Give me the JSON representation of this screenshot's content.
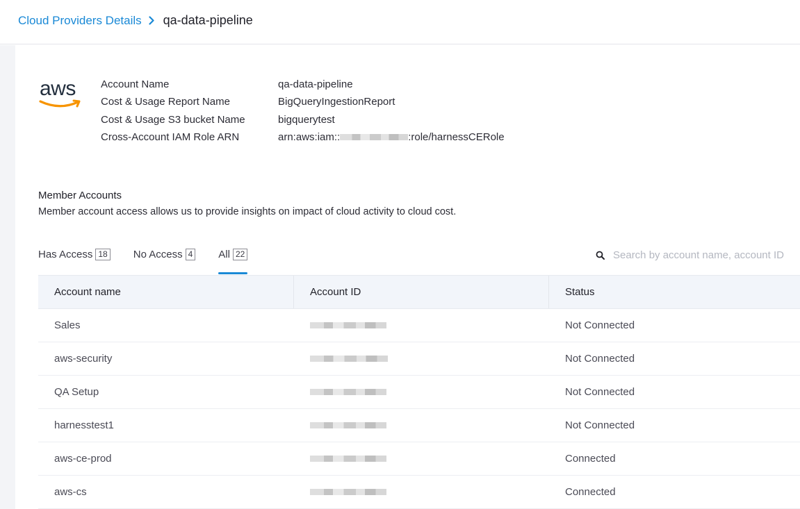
{
  "breadcrumb": {
    "parent": "Cloud Providers Details",
    "current": "qa-data-pipeline"
  },
  "provider": {
    "logo_text": "aws",
    "details": [
      {
        "label": "Account Name",
        "value": "qa-data-pipeline"
      },
      {
        "label": "Cost & Usage Report Name",
        "value": "BigQueryIngestionReport"
      },
      {
        "label": "Cost & Usage S3 bucket Name",
        "value": "bigquerytest"
      },
      {
        "label": "Cross-Account IAM Role ARN",
        "value_prefix": "arn:aws:iam::",
        "value_suffix": ":role/harnessCERole"
      }
    ]
  },
  "member_accounts": {
    "title": "Member Accounts",
    "description": "Member account access allows us to provide insights on impact of cloud activity to cloud cost."
  },
  "tabs": [
    {
      "label": "Has Access",
      "count": "18",
      "active": false
    },
    {
      "label": "No Access",
      "count": "4",
      "active": false
    },
    {
      "label": "All",
      "count": "22",
      "active": true
    }
  ],
  "search": {
    "placeholder": "Search by account name, account ID",
    "icon": "search-icon"
  },
  "table": {
    "columns": [
      "Account name",
      "Account ID",
      "Status"
    ],
    "rows": [
      {
        "name": "Sales",
        "status": "Not Connected"
      },
      {
        "name": "aws-security",
        "status": "Not Connected"
      },
      {
        "name": "QA Setup",
        "status": "Not Connected"
      },
      {
        "name": "harnesstest1",
        "status": "Not Connected"
      },
      {
        "name": "aws-ce-prod",
        "status": "Connected"
      },
      {
        "name": "aws-cs",
        "status": "Connected"
      }
    ]
  },
  "colors": {
    "accent": "#1a89d6",
    "aws_smile": "#f79400",
    "table_header_bg": "#f2f5fa"
  }
}
